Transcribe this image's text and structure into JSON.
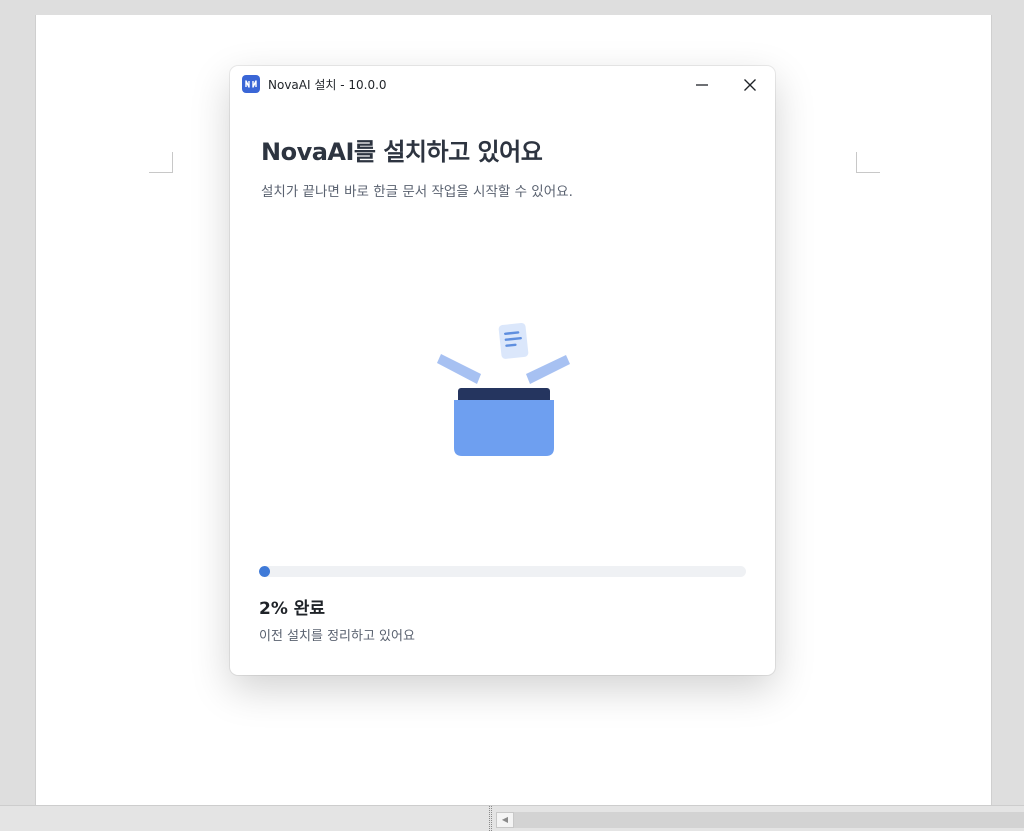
{
  "window": {
    "title": "NovaAI 설치 - 10.0.0",
    "minimize_icon": "minimize-icon",
    "close_icon": "close-icon",
    "app_icon": "novaai-logo-icon",
    "accent_color": "#3a66d6"
  },
  "installer": {
    "headline": "NovaAI를 설치하고 있어요",
    "subline": "설치가 끝나면 바로 한글 문서 작업을 시작할 수 있어요.",
    "illustration": "open-box-document-illustration",
    "progress": {
      "percent_value": 2,
      "percent_label": "2% 완료",
      "status": "이전 설치를 정리하고 있어요",
      "fill_color": "#3f7ad8"
    }
  },
  "background_app": {
    "scroll_left_icon": "scroll-left-arrow-icon"
  }
}
